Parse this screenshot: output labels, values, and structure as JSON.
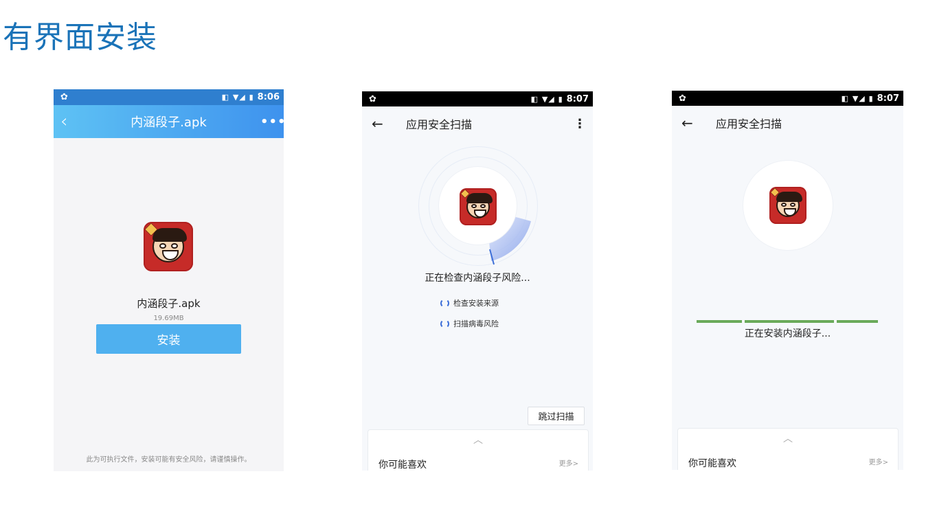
{
  "page": {
    "title": "有界面安装"
  },
  "screen1": {
    "status_time": "8:06",
    "status_icons": "◧ ▼◢ ▮",
    "header": {
      "back": "‹",
      "title": "内涵段子.apk",
      "more": "•••"
    },
    "app_name": "内涵段子.apk",
    "app_size": "19.69MB",
    "install_button": "安装",
    "warning": "此为可执行文件，安装可能有安全风险，请谨慎操作。"
  },
  "screen2": {
    "status_time": "8:07",
    "status_icons": "◧ ▼◢ ▮",
    "header": {
      "back": "←",
      "title": "应用安全扫描",
      "more": "⋮"
    },
    "status_text": "正在检查内涵段子风险...",
    "checks": [
      "检查安装来源",
      "扫描病毒风险"
    ],
    "skip_button": "跳过扫描",
    "recommend": {
      "label": "你可能喜欢",
      "more": "更多>",
      "chevron": "︿"
    }
  },
  "screen3": {
    "status_time": "8:07",
    "status_icons": "◧ ▼◢ ▮",
    "header": {
      "back": "←",
      "title": "应用安全扫描"
    },
    "status_text": "正在安装内涵段子...",
    "recommend": {
      "label": "你可能喜欢",
      "more": "更多>",
      "chevron": "︿"
    },
    "progress_color": "#6aaa5a"
  },
  "colors": {
    "title": "#1a73b8",
    "accent_blue": "#4fb0ef",
    "spinner": "#3d6fd8"
  }
}
